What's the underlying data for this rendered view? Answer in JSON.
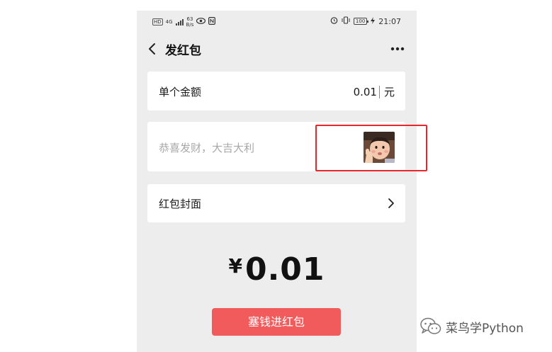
{
  "status_bar": {
    "hd": "HD",
    "network": "4G",
    "speed_value": "63",
    "speed_unit": "B/s",
    "battery": "100",
    "time": "21:07"
  },
  "nav": {
    "title": "发红包"
  },
  "amount_row": {
    "label": "单个金额",
    "value": "0.01",
    "unit": "元"
  },
  "greeting": {
    "placeholder": "恭喜发财，大吉大利"
  },
  "cover_row": {
    "label": "红包封面"
  },
  "total": {
    "currency": "¥",
    "amount": "0.01"
  },
  "submit": {
    "label": "塞钱进红包"
  },
  "watermark": {
    "text": "菜鸟学Python"
  },
  "colors": {
    "page_bg": "#ededed",
    "card_bg": "#ffffff",
    "button_bg": "#f25b5c",
    "highlight": "#e8262b"
  }
}
